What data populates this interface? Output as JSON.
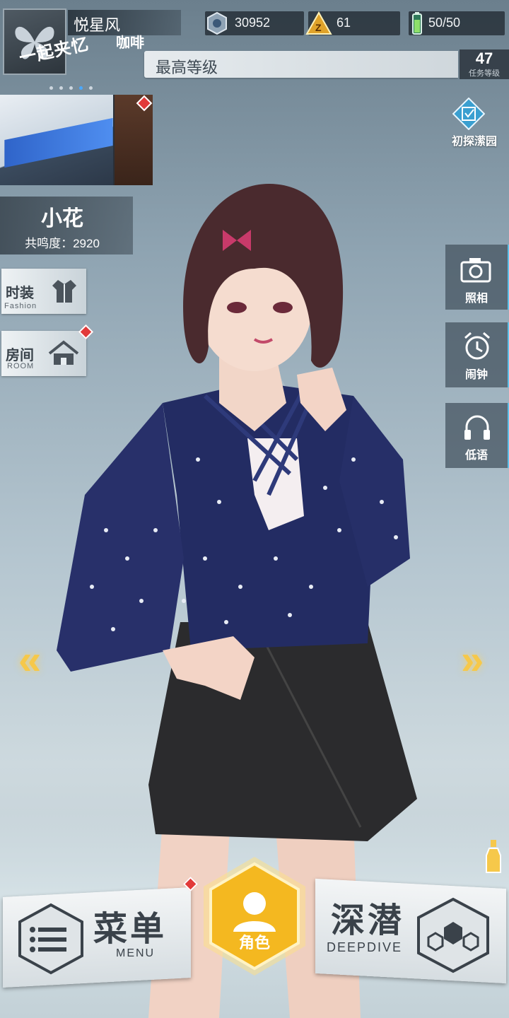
{
  "player": {
    "name": "悦星风"
  },
  "resources": [
    {
      "icon": "crystal-coin-icon",
      "value": "30952"
    },
    {
      "icon": "gold-triangle-icon",
      "value": "61"
    },
    {
      "icon": "energy-battery-icon",
      "value": "50/50"
    }
  ],
  "rank": {
    "label": "最高等级",
    "level": "47",
    "level_caption": "任务等级"
  },
  "banner": {
    "title": "一起夹忆",
    "side_text": "咖啡",
    "dots": 5,
    "active_dot": 3
  },
  "explore": {
    "label": "初探潆园"
  },
  "character": {
    "name": "小花",
    "affinity": "共鸣度：2920"
  },
  "left_buttons": {
    "fashion": {
      "title": "时装",
      "sub": "Fashion"
    },
    "room": {
      "title": "房间",
      "sub": "ROOM"
    }
  },
  "right_buttons": {
    "photo": "照相",
    "alarm": "闹钟",
    "whisper": "低语"
  },
  "bottom": {
    "menu_title": "菜单",
    "menu_sub": "MENU",
    "role_label": "角色",
    "dive_title": "深潜",
    "dive_sub": "DEEPDIVE"
  },
  "colors": {
    "accent_gold": "#f6c84a",
    "badge_red": "#e23a3a",
    "accent_cyan": "#5fc0e8"
  }
}
